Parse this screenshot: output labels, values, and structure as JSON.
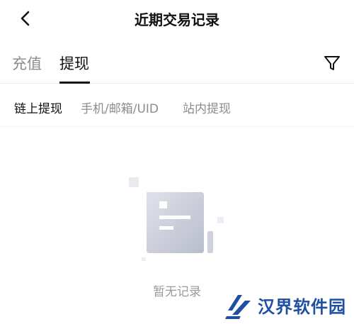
{
  "header": {
    "title": "近期交易记录",
    "back_icon": "chevron-left-icon"
  },
  "tabs": [
    {
      "label": "充值",
      "active": false
    },
    {
      "label": "提现",
      "active": true
    }
  ],
  "filter_icon": "filter-funnel-icon",
  "subtabs": [
    {
      "label": "链上提现",
      "active": true
    },
    {
      "label": "手机/邮箱/UID",
      "active": false
    },
    {
      "label": "站内提现",
      "active": false
    }
  ],
  "empty_state": {
    "text": "暂无记录",
    "icon": "empty-document-icon"
  },
  "watermark": {
    "text": "汉界软件园",
    "color": "#1e4fa3"
  }
}
